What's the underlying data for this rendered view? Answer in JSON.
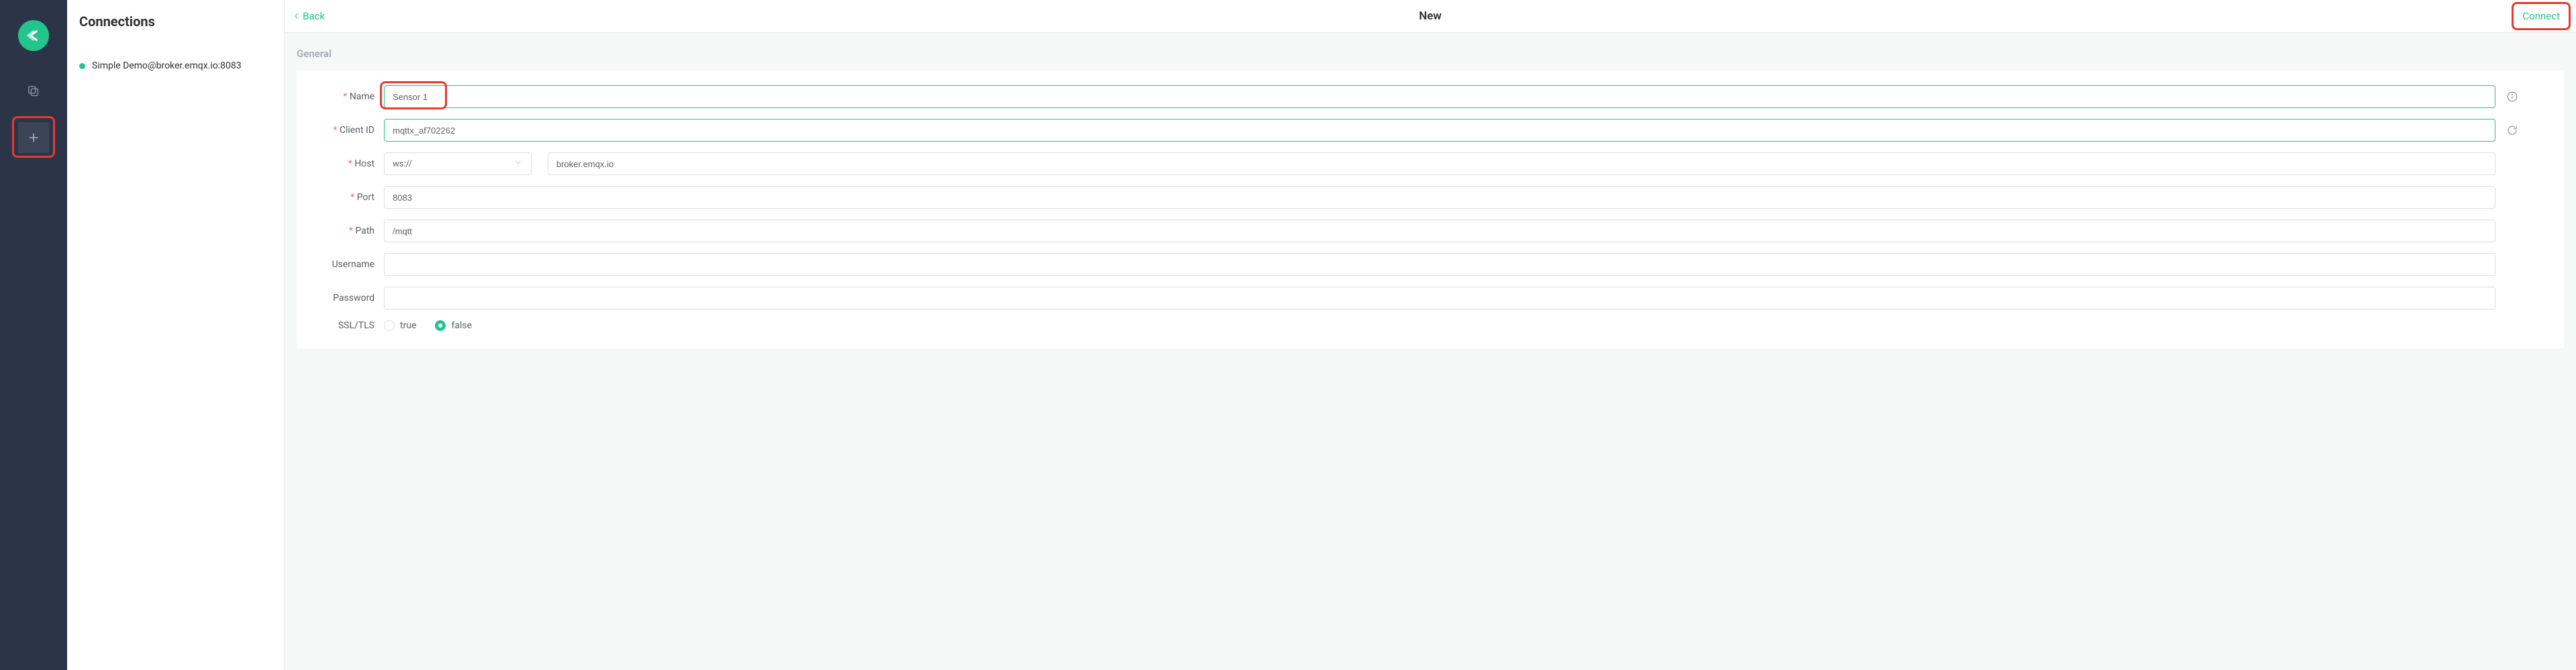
{
  "sidebar": {
    "title": "Connections",
    "items": [
      {
        "label": "Simple Demo@broker.emqx.io:8083",
        "online": true
      }
    ]
  },
  "topbar": {
    "back_label": "Back",
    "title": "New",
    "connect_label": "Connect"
  },
  "form": {
    "section_title": "General",
    "labels": {
      "name": "Name",
      "client_id": "Client ID",
      "host": "Host",
      "port": "Port",
      "path": "Path",
      "username": "Username",
      "password": "Password",
      "ssl": "SSL/TLS"
    },
    "values": {
      "name": "Sensor 1",
      "client_id": "mqttx_af702262",
      "host_scheme": "ws://",
      "host": "broker.emqx.io",
      "port": "8083",
      "path": "/mqtt",
      "username": "",
      "password": "",
      "ssl": "false"
    },
    "ssl_options": {
      "true": "true",
      "false": "false"
    }
  }
}
